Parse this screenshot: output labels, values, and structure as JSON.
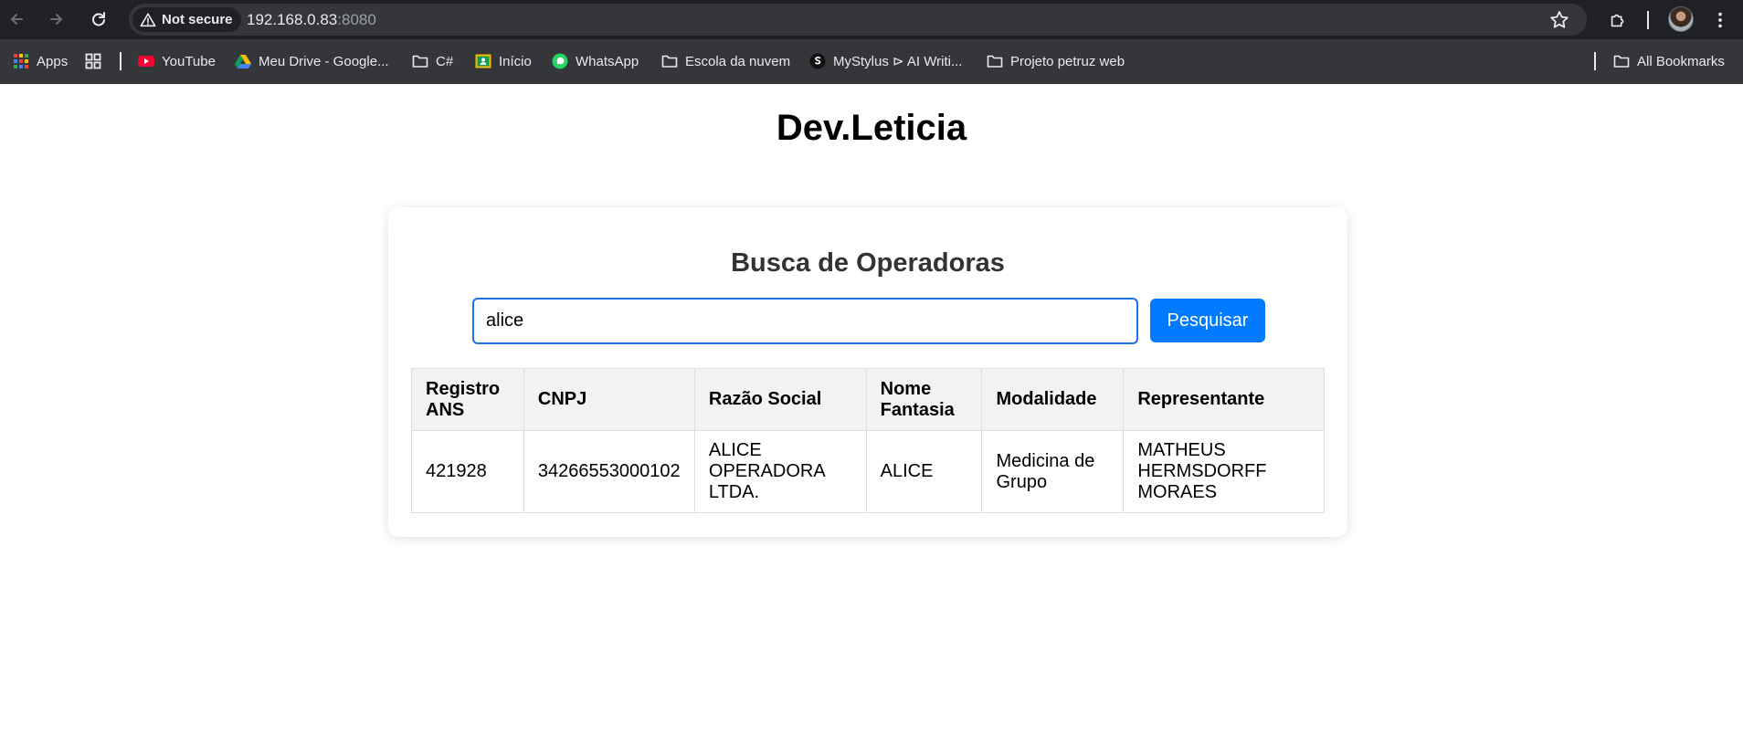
{
  "browser": {
    "security_label": "Not secure",
    "url_host": "192.168.0.83",
    "url_port": ":8080",
    "bookmarks": {
      "apps": "Apps",
      "youtube": "YouTube",
      "drive": "Meu Drive - Google...",
      "csharp": "C#",
      "inicio": "Início",
      "whatsapp": "WhatsApp",
      "escola": "Escola da nuvem",
      "mystylus": "MyStylus ⊳ AI Writi...",
      "projeto": "Projeto petruz web",
      "all_bookmarks": "All Bookmarks"
    }
  },
  "page": {
    "site_title": "Dev.Leticia",
    "card_title": "Busca de Operadoras",
    "search": {
      "value": "alice",
      "button_label": "Pesquisar"
    },
    "table": {
      "headers": [
        "Registro ANS",
        "CNPJ",
        "Razão Social",
        "Nome Fantasia",
        "Modalidade",
        "Representante"
      ],
      "rows": [
        [
          "421928",
          "34266553000102",
          "ALICE OPERADORA LTDA.",
          "ALICE",
          "Medicina de Grupo",
          "MATHEUS HERMSDORFF MORAES"
        ]
      ]
    }
  },
  "colors": {
    "accent": "#007bff",
    "input_border": "#1a73e8",
    "chrome_dark": "#202124",
    "chrome_toolbar": "#35363a"
  }
}
